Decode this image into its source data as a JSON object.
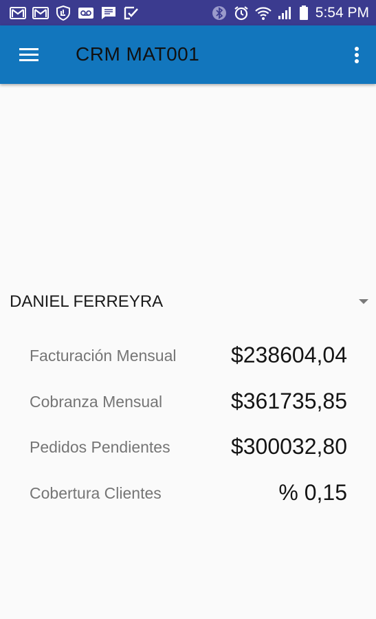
{
  "status_bar": {
    "time": "5:54 PM",
    "left_icons": [
      "gmail-icon",
      "gmail-icon",
      "shield-icon",
      "voicemail-icon",
      "message-icon",
      "checklist-icon"
    ],
    "right_icons": [
      "bluetooth-icon",
      "alarm-icon",
      "wifi-icon",
      "signal-icon",
      "battery-icon"
    ]
  },
  "app_bar": {
    "title": "CRM MAT001",
    "menu_icon": "hamburger-icon",
    "overflow_icon": "more-vert-icon",
    "color": "#1276bd"
  },
  "selector": {
    "value": "DANIEL FERREYRA"
  },
  "metrics": [
    {
      "label": "Facturación Mensual",
      "value": "$238604,04"
    },
    {
      "label": "Cobranza Mensual",
      "value": "$361735,85"
    },
    {
      "label": "Pedidos Pendientes",
      "value": "$300032,80"
    },
    {
      "label": "Cobertura Clientes",
      "value": "% 0,15"
    }
  ]
}
